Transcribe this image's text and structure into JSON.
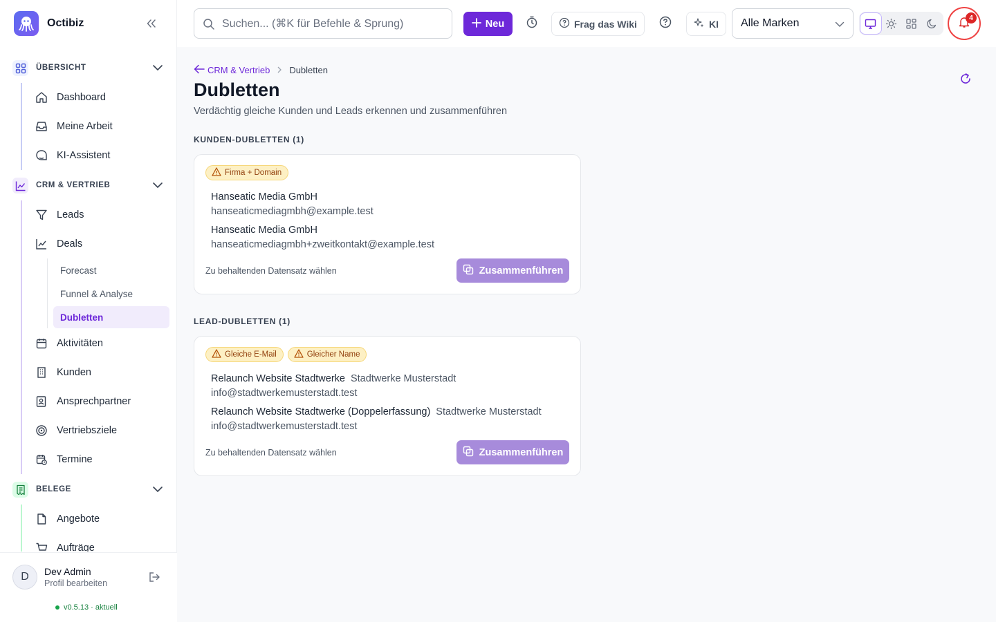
{
  "app": {
    "name": "Octibiz"
  },
  "sidebar": {
    "sections": [
      {
        "label": "ÜBERSICHT",
        "items": [
          "Dashboard",
          "Meine Arbeit",
          "KI-Assistent"
        ]
      },
      {
        "label": "CRM & VERTRIEB",
        "items": [
          "Leads",
          "Deals",
          "Aktivitäten",
          "Kunden",
          "Ansprechpartner",
          "Vertriebsziele",
          "Termine"
        ],
        "deals_sub": [
          "Forecast",
          "Funnel & Analyse",
          "Dubletten"
        ]
      },
      {
        "label": "BELEGE",
        "items": [
          "Angebote",
          "Aufträge"
        ]
      }
    ],
    "user": {
      "initial": "D",
      "name": "Dev Admin",
      "edit": "Profil bearbeiten"
    },
    "version": "v0.5.13 · aktuell"
  },
  "topbar": {
    "search_placeholder": "Suchen... (⌘K für Befehle & Sprung)",
    "new_label": "Neu",
    "wiki_label": "Frag das Wiki",
    "ai_label": "KI",
    "brand_select": "Alle Marken",
    "notifications": "4"
  },
  "page": {
    "breadcrumb_parent": "CRM & Vertrieb",
    "breadcrumb_current": "Dubletten",
    "title": "Dubletten",
    "subtitle": "Verdächtig gleiche Kunden und Leads erkennen und zusammenführen",
    "customer_section": "KUNDEN-DUBLETTEN (1)",
    "lead_section": "LEAD-DUBLETTEN (1)",
    "customer_card": {
      "tags": [
        "Firma + Domain"
      ],
      "records": [
        {
          "name": "Hanseatic Media GmbH",
          "email": "hanseaticmediagmbh@example.test"
        },
        {
          "name": "Hanseatic Media GmbH",
          "email": "hanseaticmediagmbh+zweitkontakt@example.test"
        }
      ],
      "hint": "Zu behaltenden Datensatz wählen",
      "merge_label": "Zusammenführen"
    },
    "lead_card": {
      "tags": [
        "Gleiche E-Mail",
        "Gleicher Name"
      ],
      "records": [
        {
          "name": "Relaunch Website Stadtwerke",
          "org": "Stadtwerke Musterstadt",
          "email": "info@stadtwerkemusterstadt.test"
        },
        {
          "name": "Relaunch Website Stadtwerke (Doppelerfassung)",
          "org": "Stadtwerke Musterstadt",
          "email": "info@stadtwerkemusterstadt.test"
        }
      ],
      "hint": "Zu behaltenden Datensatz wählen",
      "merge_label": "Zusammenführen"
    }
  },
  "colors": {
    "accent": "#6d28d9",
    "merge": "#a78bdb",
    "warning_bg": "#fdf0c4",
    "notification": "#dc2626"
  }
}
